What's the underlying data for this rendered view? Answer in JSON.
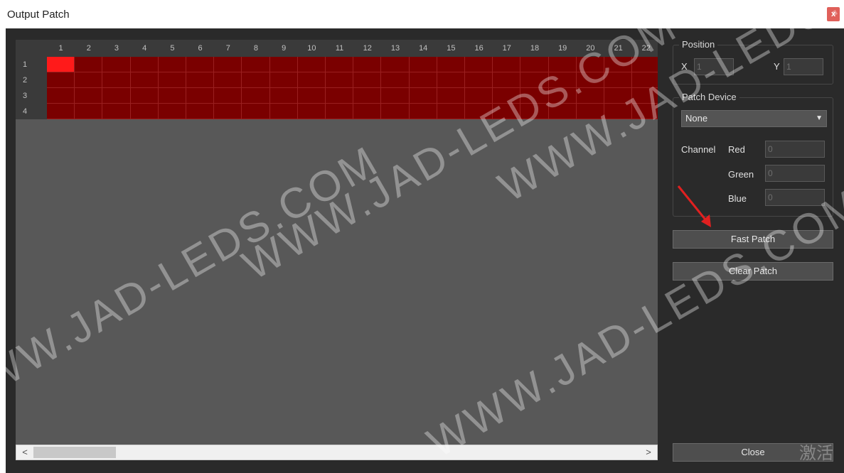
{
  "window": {
    "title": "Output Patch",
    "close_glyph": "x"
  },
  "grid": {
    "columns": [
      "1",
      "2",
      "3",
      "4",
      "5",
      "6",
      "7",
      "8",
      "9",
      "10",
      "11",
      "12",
      "13",
      "14",
      "15",
      "16",
      "17",
      "18",
      "19",
      "20",
      "21",
      "22"
    ],
    "rows": [
      "1",
      "2",
      "3",
      "4"
    ],
    "selected_cell": {
      "row": 1,
      "col": 1
    },
    "cell_color": "#7a0000",
    "selected_color": "#ff1a1a"
  },
  "scrollbar": {
    "left_arrow": "<",
    "right_arrow": ">"
  },
  "position": {
    "label": "Position",
    "x_label": "X",
    "x_value": "1",
    "y_label": "Y",
    "y_value": "1"
  },
  "patch_device": {
    "label": "Patch Device",
    "selected": "None",
    "channel_label": "Channel",
    "red_label": "Red",
    "red_value": "0",
    "green_label": "Green",
    "green_value": "0",
    "blue_label": "Blue",
    "blue_value": "0"
  },
  "buttons": {
    "fast_patch": "Fast Patch",
    "clear_patch": "Clear Patch",
    "close": "Close"
  },
  "watermarks": [
    "WWW.JAD-LEDS.COM",
    "WWW.JAD-LEDS.COM",
    "WWW.JAD-LEDS.COM",
    "WWW.JAD-LEDS.COM"
  ],
  "system_overlay": {
    "activate_text": "激活"
  },
  "colors": {
    "accent_arrow": "#e02020",
    "background": "#2a2a2a"
  }
}
